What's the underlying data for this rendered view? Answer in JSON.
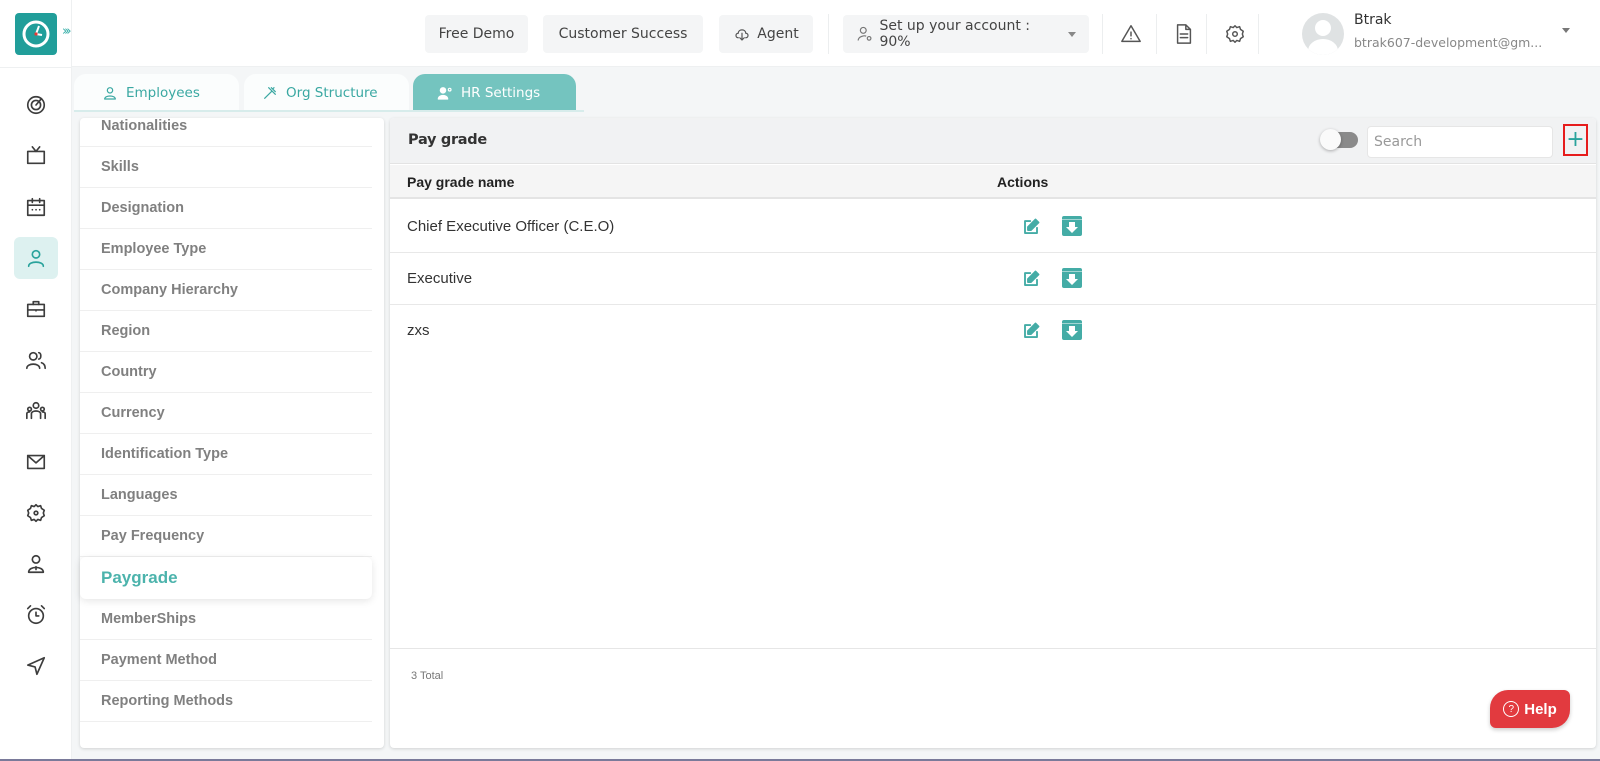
{
  "app": {
    "brand_color": "#219e9a",
    "accent_color": "#4cb3ac",
    "expand_icon": "triple-chevron-right-icon"
  },
  "rail": {
    "items": [
      {
        "name": "dashboard",
        "icon": "radar-icon",
        "active": false
      },
      {
        "name": "tv",
        "icon": "tv-icon",
        "active": false
      },
      {
        "name": "calendar",
        "icon": "calendar-icon",
        "active": false
      },
      {
        "name": "employees",
        "icon": "user-icon",
        "active": true
      },
      {
        "name": "projects",
        "icon": "briefcase-icon",
        "active": false
      },
      {
        "name": "team",
        "icon": "users-icon",
        "active": false
      },
      {
        "name": "org",
        "icon": "group-icon",
        "active": false
      },
      {
        "name": "mail",
        "icon": "mail-icon",
        "active": false
      },
      {
        "name": "settings",
        "icon": "gear-icon",
        "active": false
      },
      {
        "name": "profile",
        "icon": "person-badge-icon",
        "active": false
      },
      {
        "name": "timer",
        "icon": "alarm-clock-icon",
        "active": false
      },
      {
        "name": "send",
        "icon": "send-icon",
        "active": false
      }
    ]
  },
  "topbar": {
    "free_demo": "Free Demo",
    "customer_success": "Customer Success",
    "agent": "Agent",
    "setup_account": "Set up your account : 90%",
    "setup_progress_percent": 90,
    "user": {
      "name": "Btrak",
      "email": "btrak607-development@gm..."
    }
  },
  "tabs": [
    {
      "label": "Employees",
      "icon": "user-icon",
      "active": false
    },
    {
      "label": "Org Structure",
      "icon": "tools-icon",
      "active": false
    },
    {
      "label": "HR Settings",
      "icon": "user-gear-icon",
      "active": true
    }
  ],
  "settings_nav": {
    "items": [
      {
        "label": "Nationalities",
        "active": false
      },
      {
        "label": "Skills",
        "active": false
      },
      {
        "label": "Designation",
        "active": false
      },
      {
        "label": "Employee Type",
        "active": false
      },
      {
        "label": "Company Hierarchy",
        "active": false
      },
      {
        "label": "Region",
        "active": false
      },
      {
        "label": "Country",
        "active": false
      },
      {
        "label": "Currency",
        "active": false
      },
      {
        "label": "Identification Type",
        "active": false
      },
      {
        "label": "Languages",
        "active": false
      },
      {
        "label": "Pay Frequency",
        "active": false
      },
      {
        "label": "Paygrade",
        "active": true
      },
      {
        "label": "MemberShips",
        "active": false
      },
      {
        "label": "Payment Method",
        "active": false
      },
      {
        "label": "Reporting Methods",
        "active": false
      }
    ]
  },
  "panel": {
    "title": "Pay grade",
    "search_placeholder": "Search",
    "search_value": "",
    "archived_toggle_on": false,
    "add_label": "+",
    "columns": [
      "Pay grade name",
      "Actions"
    ],
    "rows": [
      {
        "name": "Chief Executive Officer (C.E.O)"
      },
      {
        "name": "Executive"
      },
      {
        "name": "zxs"
      }
    ],
    "total": "3 Total"
  },
  "help": {
    "label": "Help",
    "icon": "?"
  }
}
